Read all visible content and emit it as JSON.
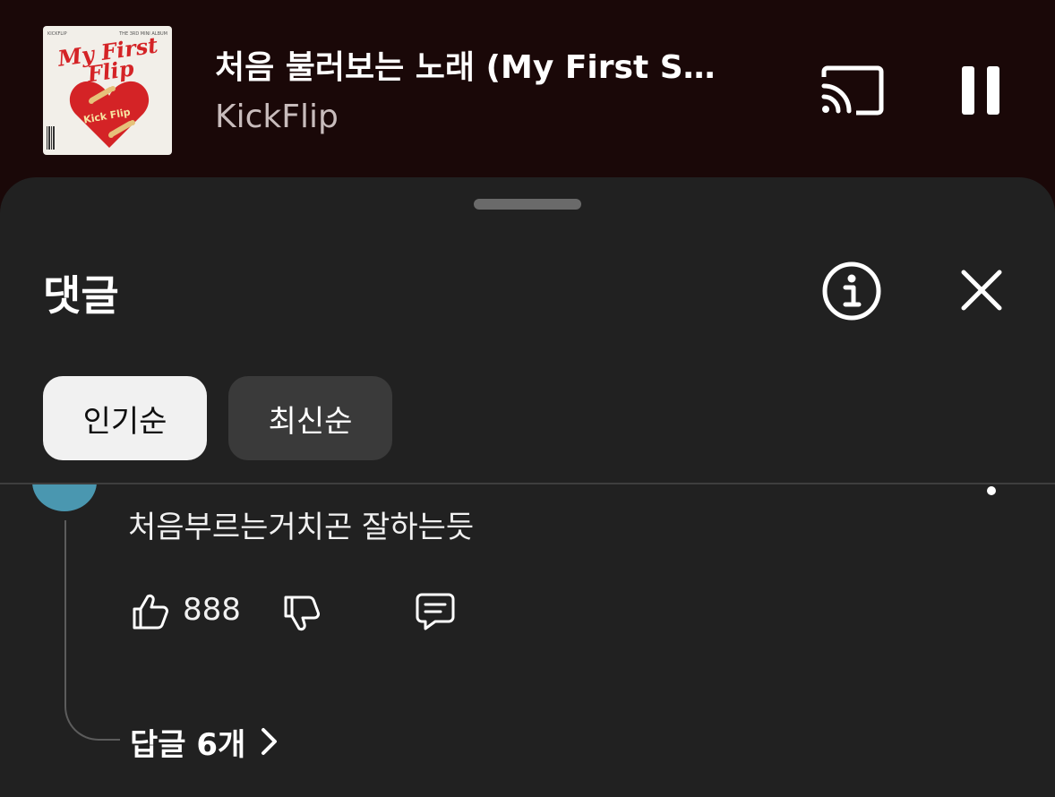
{
  "player": {
    "album_art": {
      "small_left": "KICKFLIP",
      "small_right": "THE 3RD MINI ALBUM",
      "title": "My First Flip",
      "heart_text": "Kick Flip"
    },
    "title": "처음 불러보는 노래 (My First Song)",
    "artist": "KickFlip",
    "cast_icon": "cast-icon",
    "pause_icon": "pause-icon"
  },
  "comments_panel": {
    "title": "댓글",
    "info_icon": "info-icon",
    "close_icon": "close-icon",
    "sort_chips": [
      "인기순",
      "최신순"
    ],
    "selected_sort": "인기순",
    "comment": {
      "text": "처음부르는거치곤 잘하는듯",
      "like_count": "888",
      "replies_label": "답글 6개"
    }
  },
  "colors": {
    "player_bg": "#1a0808",
    "sheet_bg": "#212121",
    "chip_selected": "#f1f1f1",
    "chip_unselected": "#3a3a3a",
    "avatar": "#4a97b0",
    "album_red": "#d42326"
  }
}
